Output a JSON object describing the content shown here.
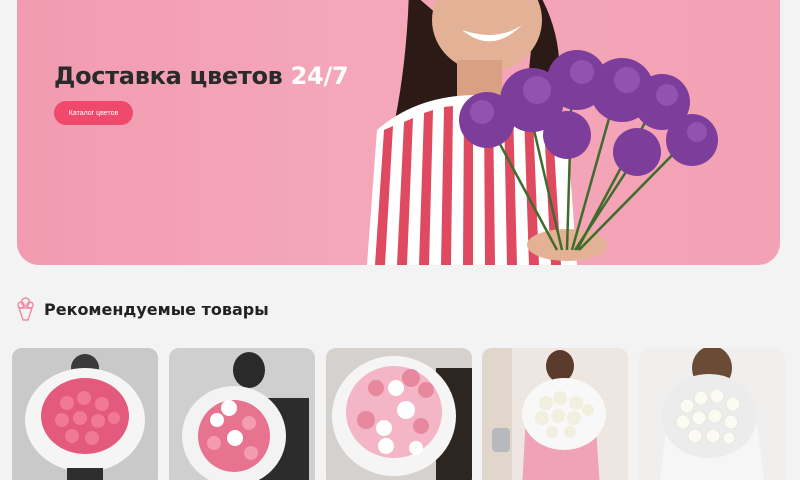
{
  "hero": {
    "title_main": "Доставка цветов",
    "title_accent": "24/7",
    "button_label": "Каталог цветов"
  },
  "section": {
    "title": "Рекомендуемые товары",
    "icon": "bouquet-icon"
  },
  "colors": {
    "accent": "#ef4a6c",
    "hero_bg": "#f5a7ba",
    "page_bg": "#f3f3f3"
  },
  "products": [
    {
      "image": "pink-roses-bouquet"
    },
    {
      "image": "pink-roses-orchids-bouquet"
    },
    {
      "image": "pink-hydrangea-orchids-bouquet"
    },
    {
      "image": "white-roses-bouquet-pink-suit"
    },
    {
      "image": "white-roses-bouquet"
    }
  ]
}
